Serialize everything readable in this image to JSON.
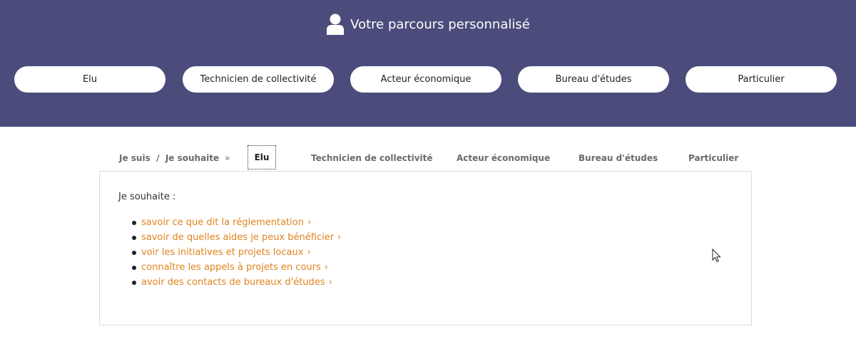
{
  "header": {
    "title": "Votre parcours personnalisé",
    "icon": "user-icon",
    "background": "#4b4c7b"
  },
  "profiles": [
    "Elu",
    "Technicien de collectivité",
    "Acteur économique",
    "Bureau d'études",
    "Particulier"
  ],
  "tabs": {
    "prefix": "Je suis  /  Je souhaite",
    "prefix_chevron": "»",
    "active": "Elu",
    "items": [
      "Elu",
      "Technicien de collectivité",
      "Acteur économique",
      "Bureau d'études",
      "Particulier"
    ]
  },
  "panel": {
    "intro": "Je souhaite :",
    "link_color": "#e0831e",
    "arrow": "›",
    "items": [
      "savoir ce que dit la réglementation",
      "savoir de quelles aides je peux bénéficier",
      "voir les initiatives et projets locaux",
      "connaître les appels à projets en cours",
      "avoir des contacts de bureaux d'études"
    ]
  }
}
